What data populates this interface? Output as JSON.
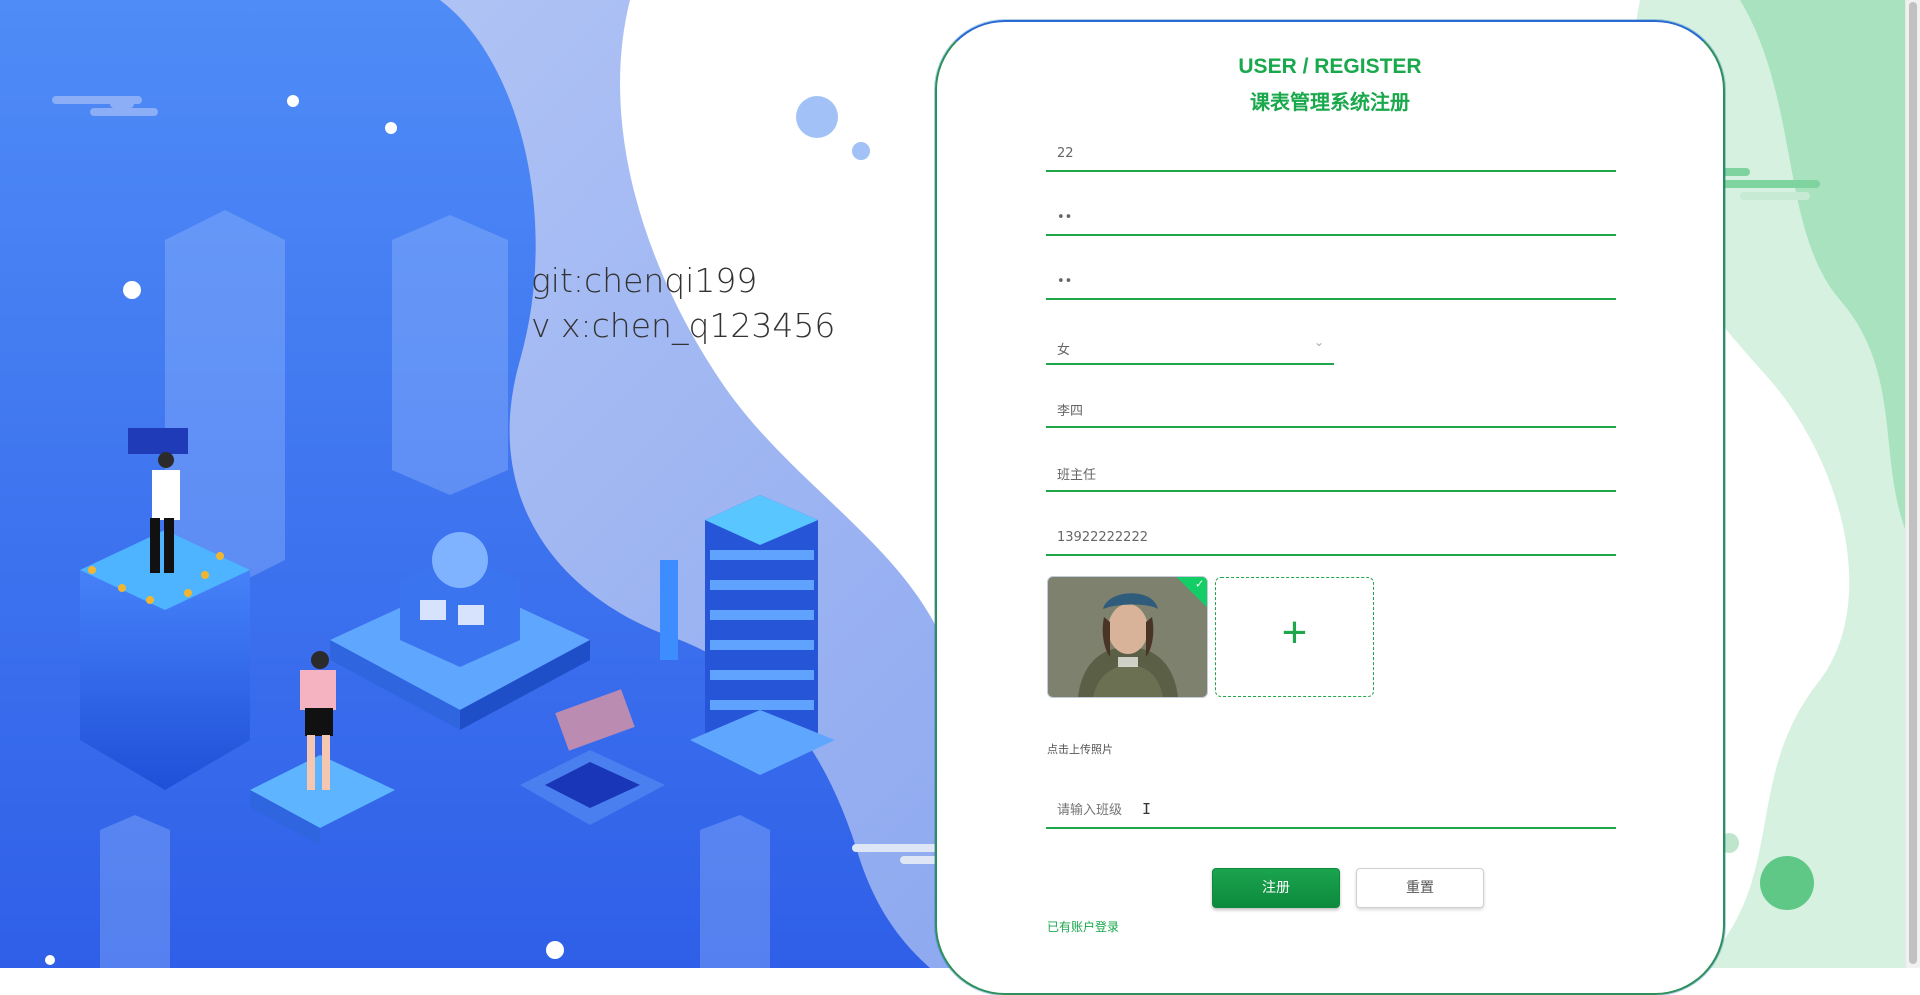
{
  "watermark": {
    "line1": "git:chenqi199",
    "line2": "v x:chen_q123456"
  },
  "form": {
    "title_en": "USER / REGISTER",
    "title_cn": "课表管理系统注册",
    "username_value": "22",
    "password_value": "••",
    "confirm_password_value": "••",
    "gender_value": "女",
    "name_value": "李四",
    "role_value": "班主任",
    "phone_value": "13922222222",
    "upload_tip": "点击上传照片",
    "class_placeholder": "请输入班级",
    "register_label": "注册",
    "reset_label": "重置",
    "login_link": "已有账户登录",
    "upload_plus": "+",
    "upload_check": "✓"
  },
  "colors": {
    "accent": "#19a84b",
    "bg_blue": "#2f6ef0"
  }
}
